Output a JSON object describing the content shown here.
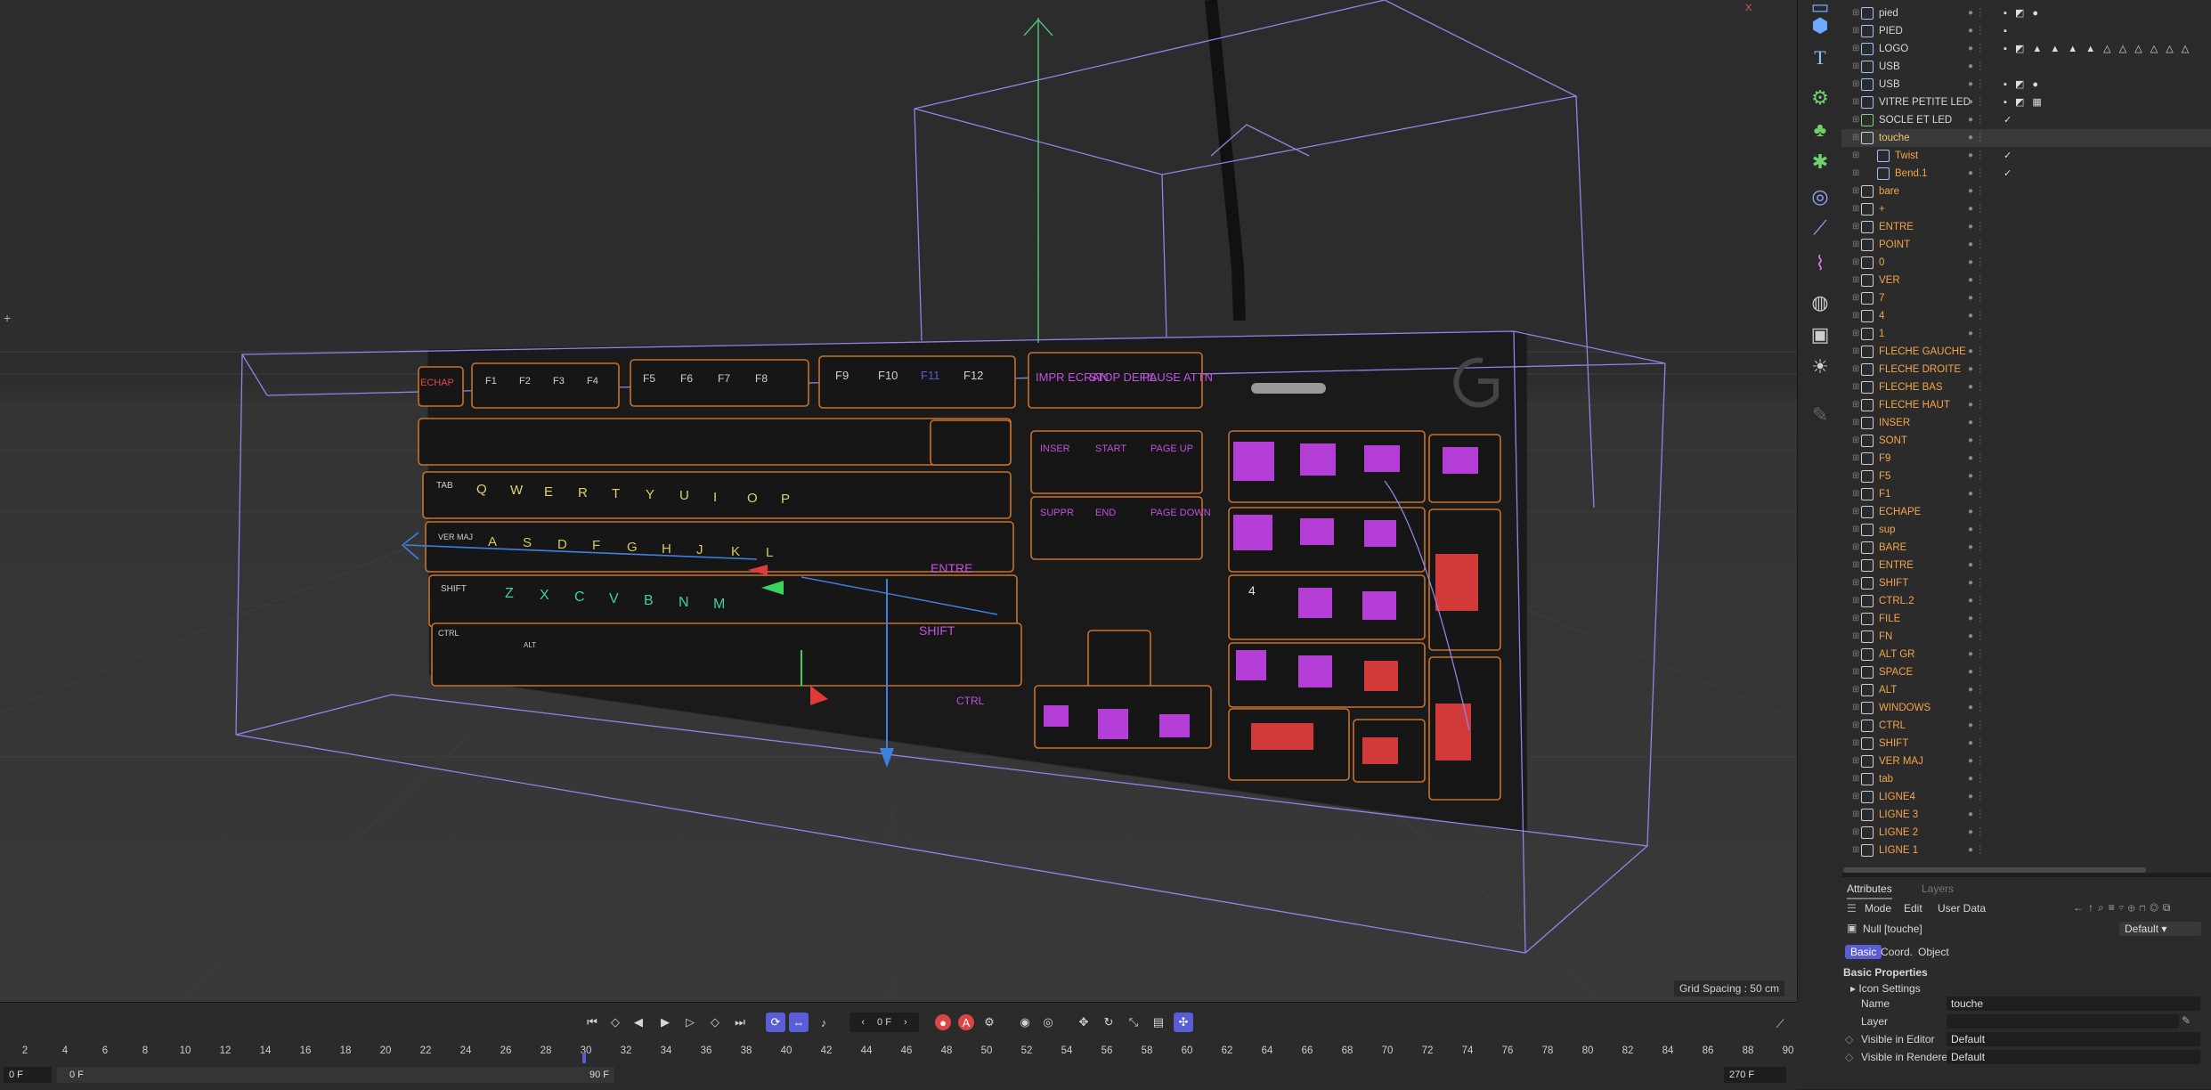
{
  "viewport": {
    "grid_spacing": "Grid Spacing : 50 cm",
    "keyboard": {
      "fn_keys_1": [
        "ECHAP",
        "F1",
        "F2",
        "F3",
        "F4"
      ],
      "fn_keys_2": [
        "F5",
        "F6",
        "F7",
        "F8"
      ],
      "fn_keys_3": [
        "F9",
        "F10",
        "F11",
        "F12"
      ],
      "special_keys": [
        "IMPR ECRAN",
        "STOP DEFIL",
        "PAUSE ATTN"
      ],
      "nav_keys": [
        "INSER",
        "START",
        "PAGE UP",
        "SUPPR",
        "END",
        "PAGE DOWN"
      ],
      "row_tab": [
        "TAB",
        "Q",
        "W",
        "E",
        "R",
        "T",
        "Y",
        "U",
        "I",
        "O",
        "P"
      ],
      "row_caps": [
        "VER MAJ",
        "A",
        "S",
        "D",
        "F",
        "G",
        "H",
        "J",
        "K",
        "L"
      ],
      "row_shift": [
        "SHIFT",
        "Z",
        "X",
        "C",
        "V",
        "B",
        "N",
        "M"
      ],
      "row_ctrl": [
        "CTRL",
        "ALT",
        "CTRL"
      ],
      "entre_label": "ENTRE",
      "shift_right_label": "SHIFT",
      "numpad_four": "4"
    }
  },
  "object_manager": {
    "rows": [
      {
        "name": "pied",
        "color": "#d8d8d8",
        "indent": 1,
        "tags": "▪ ◩ ●",
        "icon": "#9fc2ff"
      },
      {
        "name": "PIED",
        "color": "#d8d8d8",
        "indent": 1,
        "tags": "▪",
        "icon": "#9fc2ff"
      },
      {
        "name": "LOGO",
        "color": "#d8d8d8",
        "indent": 1,
        "tags": "▪ ◩ ▲ ▲ ▲ ▲ △ △ △ △ △ △",
        "icon": "#9fc2ff"
      },
      {
        "name": "USB",
        "color": "#d8d8d8",
        "indent": 1,
        "tags": "",
        "icon": "#9fc2ff"
      },
      {
        "name": "USB",
        "color": "#d8d8d8",
        "indent": 1,
        "tags": "▪ ◩ ●",
        "icon": "#9fc2ff"
      },
      {
        "name": "VITRE PETITE LED",
        "color": "#d8d8d8",
        "indent": 1,
        "tags": "▪ ◩ ▦",
        "icon": "#9fc2ff"
      },
      {
        "name": "SOCLE ET LED",
        "color": "#d8d8d8",
        "indent": 1,
        "tags": "✓",
        "icon": "#7bd37b"
      },
      {
        "name": "touche",
        "color": "#f5c66b",
        "indent": 1,
        "tags": "",
        "icon": "#cfcfcf"
      },
      {
        "name": "Twist",
        "color": "#f5a54a",
        "indent": 2,
        "tags": "✓",
        "icon": "#9fc2ff"
      },
      {
        "name": "Bend.1",
        "color": "#f5a54a",
        "indent": 2,
        "tags": "✓",
        "icon": "#9fc2ff"
      },
      {
        "name": "bare",
        "color": "#f5a54a",
        "indent": 1,
        "tags": "",
        "icon": "#cfcfcf"
      },
      {
        "name": "+",
        "color": "#f5a54a",
        "indent": 1,
        "tags": "",
        "icon": "#cfcfcf"
      },
      {
        "name": "ENTRE",
        "color": "#f5a54a",
        "indent": 1,
        "tags": "",
        "icon": "#cfcfcf"
      },
      {
        "name": "POINT",
        "color": "#f5a54a",
        "indent": 1,
        "tags": "",
        "icon": "#cfcfcf"
      },
      {
        "name": "0",
        "color": "#f5a54a",
        "indent": 1,
        "tags": "",
        "icon": "#cfcfcf"
      },
      {
        "name": "VER",
        "color": "#f5a54a",
        "indent": 1,
        "tags": "",
        "icon": "#cfcfcf"
      },
      {
        "name": "7",
        "color": "#f5a54a",
        "indent": 1,
        "tags": "",
        "icon": "#cfcfcf"
      },
      {
        "name": "4",
        "color": "#f5a54a",
        "indent": 1,
        "tags": "",
        "icon": "#cfcfcf"
      },
      {
        "name": "1",
        "color": "#f5a54a",
        "indent": 1,
        "tags": "",
        "icon": "#cfcfcf"
      },
      {
        "name": "FLECHE GAUCHE",
        "color": "#f5a54a",
        "indent": 1,
        "tags": "",
        "icon": "#cfcfcf"
      },
      {
        "name": "FLECHE DROITE",
        "color": "#f5a54a",
        "indent": 1,
        "tags": "",
        "icon": "#cfcfcf"
      },
      {
        "name": "FLECHE BAS",
        "color": "#f5a54a",
        "indent": 1,
        "tags": "",
        "icon": "#cfcfcf"
      },
      {
        "name": "FLECHE HAUT",
        "color": "#f5a54a",
        "indent": 1,
        "tags": "",
        "icon": "#cfcfcf"
      },
      {
        "name": "INSER",
        "color": "#f5a54a",
        "indent": 1,
        "tags": "",
        "icon": "#cfcfcf"
      },
      {
        "name": "SONT",
        "color": "#f5a54a",
        "indent": 1,
        "tags": "",
        "icon": "#cfcfcf"
      },
      {
        "name": "F9",
        "color": "#f5a54a",
        "indent": 1,
        "tags": "",
        "icon": "#cfcfcf"
      },
      {
        "name": "F5",
        "color": "#f5a54a",
        "indent": 1,
        "tags": "",
        "icon": "#cfcfcf"
      },
      {
        "name": "F1",
        "color": "#f5a54a",
        "indent": 1,
        "tags": "",
        "icon": "#cfcfcf"
      },
      {
        "name": "ECHAPE",
        "color": "#f5a54a",
        "indent": 1,
        "tags": "",
        "icon": "#cfcfcf"
      },
      {
        "name": "sup",
        "color": "#f5a54a",
        "indent": 1,
        "tags": "",
        "icon": "#cfcfcf"
      },
      {
        "name": "BARE",
        "color": "#f5a54a",
        "indent": 1,
        "tags": "",
        "icon": "#cfcfcf"
      },
      {
        "name": "ENTRE",
        "color": "#f5a54a",
        "indent": 1,
        "tags": "",
        "icon": "#cfcfcf"
      },
      {
        "name": "SHIFT",
        "color": "#f5a54a",
        "indent": 1,
        "tags": "",
        "icon": "#cfcfcf"
      },
      {
        "name": "CTRL.2",
        "color": "#f5a54a",
        "indent": 1,
        "tags": "",
        "icon": "#cfcfcf"
      },
      {
        "name": "FILE",
        "color": "#f5a54a",
        "indent": 1,
        "tags": "",
        "icon": "#cfcfcf"
      },
      {
        "name": "FN",
        "color": "#f5a54a",
        "indent": 1,
        "tags": "",
        "icon": "#cfcfcf"
      },
      {
        "name": "ALT GR",
        "color": "#f5a54a",
        "indent": 1,
        "tags": "",
        "icon": "#cfcfcf"
      },
      {
        "name": "SPACE",
        "color": "#f5a54a",
        "indent": 1,
        "tags": "",
        "icon": "#cfcfcf"
      },
      {
        "name": "ALT",
        "color": "#f5a54a",
        "indent": 1,
        "tags": "",
        "icon": "#cfcfcf"
      },
      {
        "name": "WINDOWS",
        "color": "#f5a54a",
        "indent": 1,
        "tags": "",
        "icon": "#cfcfcf"
      },
      {
        "name": "CTRL",
        "color": "#f5a54a",
        "indent": 1,
        "tags": "",
        "icon": "#cfcfcf"
      },
      {
        "name": "SHIFT",
        "color": "#f5a54a",
        "indent": 1,
        "tags": "",
        "icon": "#cfcfcf"
      },
      {
        "name": "VER MAJ",
        "color": "#f5a54a",
        "indent": 1,
        "tags": "",
        "icon": "#cfcfcf"
      },
      {
        "name": "tab",
        "color": "#f5a54a",
        "indent": 1,
        "tags": "",
        "icon": "#cfcfcf"
      },
      {
        "name": "LIGNE4",
        "color": "#f5a54a",
        "indent": 1,
        "tags": "",
        "icon": "#cfcfcf"
      },
      {
        "name": "LIGNE 3",
        "color": "#f5a54a",
        "indent": 1,
        "tags": "",
        "icon": "#cfcfcf"
      },
      {
        "name": "LIGNE 2",
        "color": "#f5a54a",
        "indent": 1,
        "tags": "",
        "icon": "#cfcfcf"
      },
      {
        "name": "LIGNE 1",
        "color": "#f5a54a",
        "indent": 1,
        "tags": "",
        "icon": "#cfcfcf"
      }
    ]
  },
  "attributes": {
    "tabs": [
      "Attributes",
      "Layers"
    ],
    "menu": [
      "Mode",
      "Edit",
      "User Data"
    ],
    "object_title": "Null [touche]",
    "preset": "Default",
    "subtabs": [
      "Basic",
      "Coord.",
      "Object"
    ],
    "section": "Basic Properties",
    "icon_settings": "Icon Settings",
    "name_label": "Name",
    "name_value": "touche",
    "layer_label": "Layer",
    "layer_value": "",
    "visible_editor_label": "Visible in Editor",
    "visible_editor_value": "Default",
    "visible_renderer_label": "Visible in Renderer",
    "visible_renderer_value": "Default"
  },
  "timeline": {
    "current_frame": "0 F",
    "ruler": [
      "2",
      "4",
      "6",
      "8",
      "10",
      "12",
      "14",
      "16",
      "18",
      "20",
      "22",
      "24",
      "26",
      "28",
      "30",
      "32",
      "34",
      "36",
      "38",
      "40",
      "42",
      "44",
      "46",
      "48",
      "50",
      "52",
      "54",
      "56",
      "58",
      "60",
      "62",
      "64",
      "66",
      "68",
      "70",
      "72",
      "74",
      "76",
      "78",
      "80",
      "82",
      "84",
      "86",
      "88",
      "90"
    ],
    "start_field": "0 F",
    "range_start": "0 F",
    "range_end": "90 F",
    "end_field": "270 F",
    "end_field_2": "90 F",
    "accent": "#5a5ed6"
  }
}
